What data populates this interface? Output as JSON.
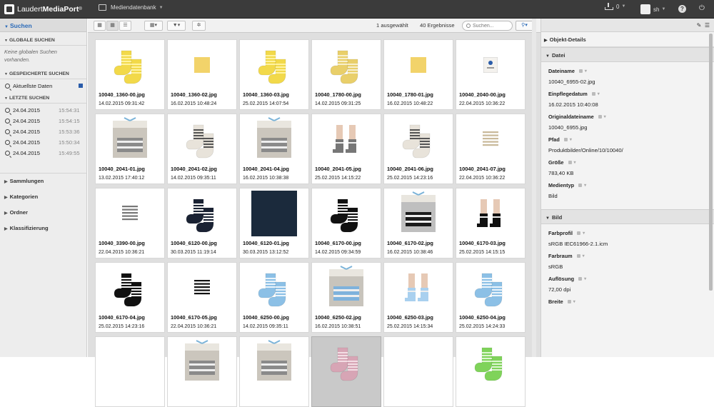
{
  "app": {
    "brand_light": "Laudert",
    "brand_bold": "MediaPort",
    "brand_reg": "®",
    "module": "Mediendatenbank"
  },
  "topbar": {
    "downloads": "0",
    "user": "sh",
    "help": "?",
    "power": "⏻"
  },
  "left": {
    "search_title": "Suchen",
    "global_title": "GLOBALE SUCHEN",
    "global_empty": "Keine globalen Suchen vorhanden.",
    "saved_title": "GESPEICHERTE SUCHEN",
    "saved": [
      {
        "label": "Aktuellste Daten"
      }
    ],
    "recent_title": "LETZTE SUCHEN",
    "recent": [
      {
        "date": "24.04.2015",
        "time": "15:54:31"
      },
      {
        "date": "24.04.2015",
        "time": "15:54:15"
      },
      {
        "date": "24.04.2015",
        "time": "15:53:36"
      },
      {
        "date": "24.04.2015",
        "time": "15:50:34"
      },
      {
        "date": "24.04.2015",
        "time": "15:49:55"
      }
    ],
    "categories": [
      "Sammlungen",
      "Kategorien",
      "Ordner",
      "Klassifizierung"
    ]
  },
  "toolbar": {
    "selected": "1 ausgewählt",
    "results": "40 Ergebnisse",
    "search_placeholder": "Suchen...",
    "filter_caret": "▾"
  },
  "files": [
    {
      "name": "10040_1360-00.jpg",
      "date": "14.02.2015 09:31:42",
      "thumb": "yellow-socks"
    },
    {
      "name": "10040_1360-02.jpg",
      "date": "16.02.2015 10:48:24",
      "thumb": "yellow-swatch"
    },
    {
      "name": "10040_1360-03.jpg",
      "date": "25.02.2015 14:07:54",
      "thumb": "yellow-socks-small"
    },
    {
      "name": "10040_1780-00.jpg",
      "date": "14.02.2015 09:31:25",
      "thumb": "beige-yellow-socks"
    },
    {
      "name": "10040_1780-01.jpg",
      "date": "16.02.2015 10:48:22",
      "thumb": "yellow-swatch"
    },
    {
      "name": "10040_2040-00.jpg",
      "date": "22.04.2015 10:36:22",
      "thumb": "label"
    },
    {
      "name": "10040_2041-01.jpg",
      "date": "13.02.2015 17:40:12",
      "thumb": "gift-box"
    },
    {
      "name": "10040_2041-02.jpg",
      "date": "14.02.2015 09:35:11",
      "thumb": "grey-striped-socks"
    },
    {
      "name": "10040_2041-04.jpg",
      "date": "16.02.2015 10:38:38",
      "thumb": "gift-box"
    },
    {
      "name": "10040_2041-05.jpg",
      "date": "25.02.2015 14:15:22",
      "thumb": "legs-grey"
    },
    {
      "name": "10040_2041-06.jpg",
      "date": "25.02.2015 14:23:16",
      "thumb": "grey-striped-socks"
    },
    {
      "name": "10040_2041-07.jpg",
      "date": "22.04.2015 10:36:22",
      "thumb": "stripes-beige"
    },
    {
      "name": "10040_3390-00.jpg",
      "date": "22.04.2015 10:36:21",
      "thumb": "stripes-grey"
    },
    {
      "name": "10040_6120-00.jpg",
      "date": "30.03.2015 11:19:14",
      "thumb": "navy-socks"
    },
    {
      "name": "10040_6120-01.jpg",
      "date": "30.03.2015 13:12:52",
      "thumb": "navy-swatch"
    },
    {
      "name": "10040_6170-00.jpg",
      "date": "14.02.2015 09:34:59",
      "thumb": "black-socks"
    },
    {
      "name": "10040_6170-02.jpg",
      "date": "16.02.2015 10:38:46",
      "thumb": "gift-box-dark"
    },
    {
      "name": "10040_6170-03.jpg",
      "date": "25.02.2015 14:15:15",
      "thumb": "legs-black"
    },
    {
      "name": "10040_6170-04.jpg",
      "date": "25.02.2015 14:23:16",
      "thumb": "black-socks"
    },
    {
      "name": "10040_6170-05.jpg",
      "date": "22.04.2015 10:36:21",
      "thumb": "stripes-black"
    },
    {
      "name": "10040_6250-00.jpg",
      "date": "14.02.2015 09:35:11",
      "thumb": "blue-socks"
    },
    {
      "name": "10040_6250-02.jpg",
      "date": "16.02.2015 10:38:51",
      "thumb": "gift-box-blue"
    },
    {
      "name": "10040_6250-03.jpg",
      "date": "25.02.2015 14:15:34",
      "thumb": "legs-blue"
    },
    {
      "name": "10040_6250-04.jpg",
      "date": "25.02.2015 14:24:33",
      "thumb": "blue-socks"
    },
    {
      "name": "",
      "date": "",
      "thumb": "white"
    },
    {
      "name": "",
      "date": "",
      "thumb": "gift-box"
    },
    {
      "name": "",
      "date": "",
      "thumb": "gift-box"
    },
    {
      "name": "",
      "date": "",
      "thumb": "pink-socks",
      "selected": true
    },
    {
      "name": "",
      "date": "",
      "thumb": "white"
    },
    {
      "name": "",
      "date": "",
      "thumb": "green-socks"
    }
  ],
  "details": {
    "title": "Objekt-Details",
    "section_file": "Datei",
    "file_fields": [
      {
        "label": "Dateiname",
        "value": "10040_6955-02.jpg"
      },
      {
        "label": "Einpflegedatum",
        "value": "16.02.2015 10:40:08"
      },
      {
        "label": "Originaldateiname",
        "value": "10040_6955.jpg"
      },
      {
        "label": "Pfad",
        "value": "Produktbilder/Online/10/10040/"
      },
      {
        "label": "Größe",
        "value": "783,40 KB"
      },
      {
        "label": "Medientyp",
        "value": "Bild"
      }
    ],
    "section_image": "Bild",
    "image_fields": [
      {
        "label": "Farbprofil",
        "value": "sRGB IEC61966-2.1.icm"
      },
      {
        "label": "Farbraum",
        "value": "sRGB"
      },
      {
        "label": "Auflösung",
        "value": "72,00 dpi"
      },
      {
        "label": "Breite",
        "value": ""
      }
    ]
  },
  "colors": {
    "accent": "#2a6ab8",
    "topbar": "#3b3b3b"
  }
}
